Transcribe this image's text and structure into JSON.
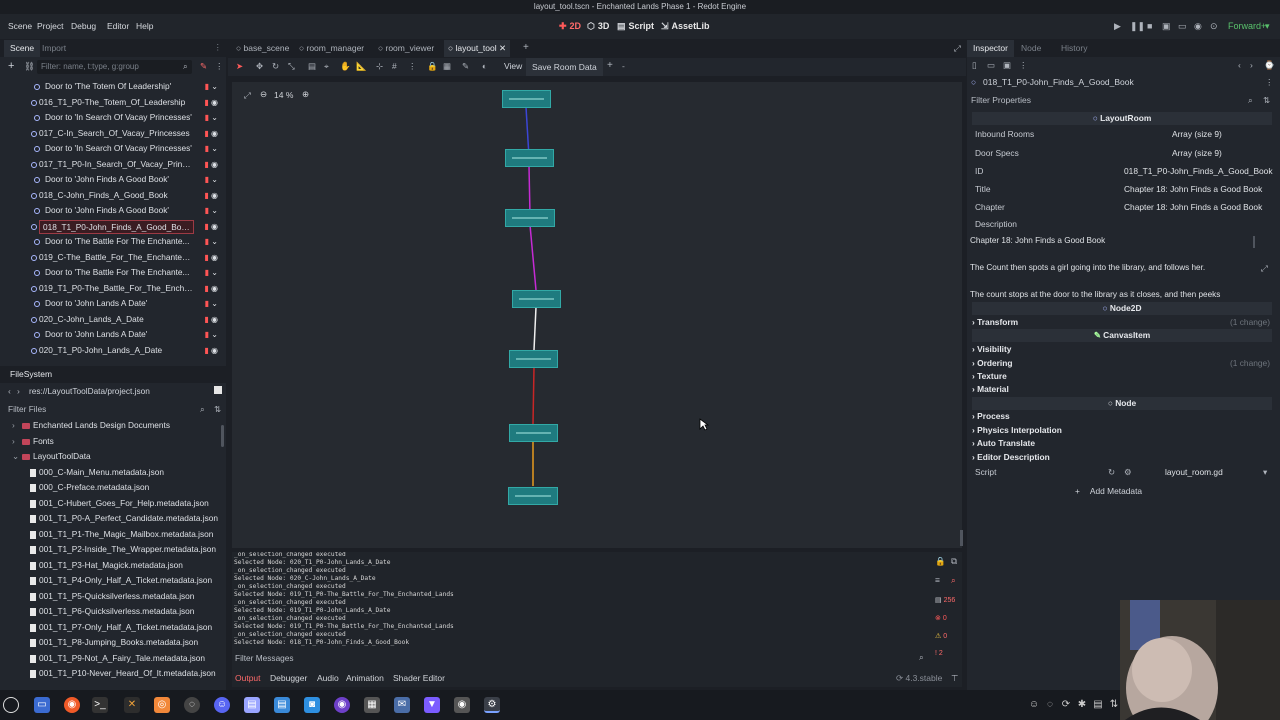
{
  "window": {
    "title": "layout_tool.tscn - Enchanted Lands Phase 1 - Redot Engine"
  },
  "menu": {
    "items": [
      "Scene",
      "Project",
      "Debug",
      "Editor",
      "Help"
    ]
  },
  "workspaces": [
    {
      "label": "2D",
      "icon": "2d-icon"
    },
    {
      "label": "3D",
      "icon": "3d-icon"
    },
    {
      "label": "Script",
      "icon": "script-icon"
    },
    {
      "label": "AssetLib",
      "icon": "assetlib-icon"
    }
  ],
  "renderer": "Forward+",
  "scene_dock": {
    "tabs": [
      "Scene",
      "Import"
    ],
    "filter_placeholder": "Filter: name, t:type, g:group",
    "items": [
      {
        "label": "Door to 'The Totem Of Leadership'",
        "indent": 2
      },
      {
        "label": "016_T1_P0-The_Totem_Of_Leadership",
        "indent": 1
      },
      {
        "label": "Door to 'In Search Of Vacay Princesses'",
        "indent": 2
      },
      {
        "label": "017_C-In_Search_Of_Vacay_Princesses",
        "indent": 1
      },
      {
        "label": "Door to 'In Search Of Vacay Princesses'",
        "indent": 2
      },
      {
        "label": "017_T1_P0-In_Search_Of_Vacay_Prince...",
        "indent": 1
      },
      {
        "label": "Door to 'John Finds A Good Book'",
        "indent": 2
      },
      {
        "label": "018_C-John_Finds_A_Good_Book",
        "indent": 1
      },
      {
        "label": "Door to 'John Finds A Good Book'",
        "indent": 2
      },
      {
        "label": "018_T1_P0-John_Finds_A_Good_Book",
        "indent": 1,
        "selected": true
      },
      {
        "label": "Door to 'The Battle For The Enchante...",
        "indent": 2
      },
      {
        "label": "019_C-The_Battle_For_The_Enchanted_L...",
        "indent": 1
      },
      {
        "label": "Door to 'The Battle For The Enchante...",
        "indent": 2
      },
      {
        "label": "019_T1_P0-The_Battle_For_The_Enchant...",
        "indent": 1
      },
      {
        "label": "Door to 'John Lands A Date'",
        "indent": 2
      },
      {
        "label": "020_C-John_Lands_A_Date",
        "indent": 1
      },
      {
        "label": "Door to 'John Lands A Date'",
        "indent": 2
      },
      {
        "label": "020_T1_P0-John_Lands_A_Date",
        "indent": 1
      }
    ]
  },
  "filesystem": {
    "title": "FileSystem",
    "path": "res://LayoutToolData/project.json",
    "filter_placeholder": "Filter Files",
    "folders": [
      "Enchanted Lands Design Documents",
      "Fonts",
      "LayoutToolData"
    ],
    "files": [
      "000_C-Main_Menu.metadata.json",
      "000_C-Preface.metadata.json",
      "001_C-Hubert_Goes_For_Help.metadata.json",
      "001_T1_P0-A_Perfect_Candidate.metadata.json",
      "001_T1_P1-The_Magic_Mailbox.metadata.json",
      "001_T1_P2-Inside_The_Wrapper.metadata.json",
      "001_T1_P3-Hat_Magick.metadata.json",
      "001_T1_P4-Only_Half_A_Ticket.metadata.json",
      "001_T1_P5-Quicksilverless.metadata.json",
      "001_T1_P6-Quicksilverless.metadata.json",
      "001_T1_P7-Only_Half_A_Ticket.metadata.json",
      "001_T1_P8-Jumping_Books.metadata.json",
      "001_T1_P9-Not_A_Fairy_Tale.metadata.json",
      "001_T1_P10-Never_Heard_Of_It.metadata.json"
    ]
  },
  "editor_tabs": [
    "base_scene",
    "room_manager",
    "room_viewer",
    "layout_tool"
  ],
  "toolbar": {
    "view_label": "View",
    "save_label": "Save Room Data",
    "zoom": "14 %"
  },
  "output": {
    "lines": [
      "_on_selection_changed executed",
      "Selected Node: 020_T1_P0-John_Lands_A_Date",
      "_on_selection_changed executed",
      "Selected Node: 020_C-John_Lands_A_Date",
      "_on_selection_changed executed",
      "Selected Node: 019_T1_P0-The_Battle_For_The_Enchanted_Lands",
      "_on_selection_changed executed",
      "Selected Node: 019_T1_P0-John_Lands_A_Date",
      "_on_selection_changed executed",
      "Selected Node: 019_T1_P0-The_Battle_For_The_Enchanted_Lands",
      "_on_selection_changed executed",
      "Selected Node: 018_T1_P0-John_Finds_A_Good_Book"
    ],
    "filter_placeholder": "Filter Messages",
    "counts": {
      "messages": "256",
      "errors": "0",
      "warnings": "0",
      "other": "2"
    },
    "bottom_tabs": [
      "Output",
      "Debugger",
      "Audio",
      "Animation",
      "Shader Editor"
    ],
    "version": "4.3.stable"
  },
  "inspector": {
    "tabs": [
      "Inspector",
      "Node",
      "History"
    ],
    "node_path": "018_T1_P0-John_Finds_A_Good_Book",
    "filter_placeholder": "Filter Properties",
    "class_header": "LayoutRoom",
    "props": [
      {
        "key": "Inbound Rooms",
        "value": "Array (size 9)"
      },
      {
        "key": "Door Specs",
        "value": "Array (size 9)"
      },
      {
        "key": "ID",
        "value": "018_T1_P0-John_Finds_A_Good_Book"
      },
      {
        "key": "Title",
        "value": "Chapter 18: John Finds a Good Book"
      },
      {
        "key": "Chapter",
        "value": "Chapter 18: John Finds a Good Book"
      },
      {
        "key": "Description",
        "value": ""
      }
    ],
    "description_lines": [
      "Chapter 18: John Finds a Good Book",
      "The Count then spots a girl going into the library, and follows her.",
      "The count stops at the door to the library as it closes, and then peeks"
    ],
    "node2d_header": "Node2D",
    "transform": {
      "label": "Transform",
      "change": "(1 change)"
    },
    "canvasitem_header": "CanvasItem",
    "canvas_sections": [
      "Visibility",
      "Ordering",
      "Texture",
      "Material"
    ],
    "ordering_change": "(1 change)",
    "node_header": "Node",
    "node_sections": [
      "Process",
      "Physics Interpolation",
      "Auto Translate",
      "Editor Description"
    ],
    "script": {
      "label": "Script",
      "value": "layout_room.gd"
    },
    "add_metadata": "Add Metadata"
  },
  "colors": {
    "accent": "#ff5a5a",
    "node_fill": "#1f7b7f",
    "node_border": "#32a9a6",
    "selection": "#9c3a44"
  }
}
